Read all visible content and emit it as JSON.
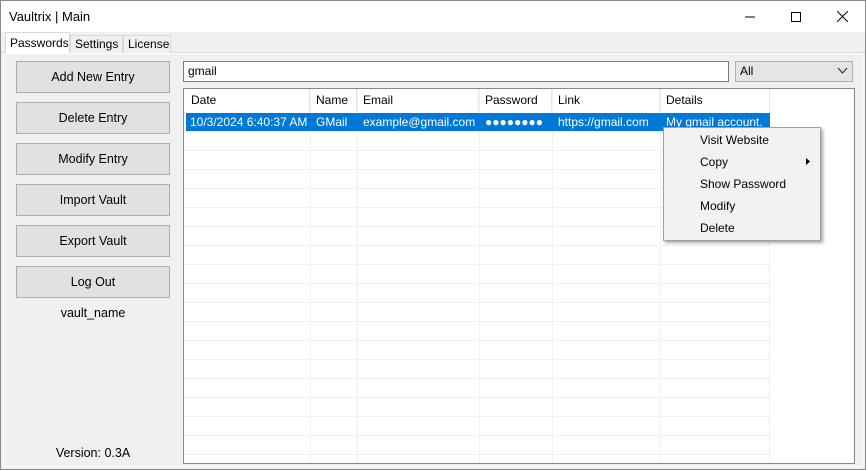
{
  "window": {
    "title": "Vaultrix | Main"
  },
  "tabs": [
    {
      "label": "Passwords"
    },
    {
      "label": "Settings"
    },
    {
      "label": "License"
    }
  ],
  "sidebar": {
    "buttons": [
      {
        "label": "Add New Entry"
      },
      {
        "label": "Delete Entry"
      },
      {
        "label": "Modify Entry"
      },
      {
        "label": "Import Vault"
      },
      {
        "label": "Export Vault"
      },
      {
        "label": "Log Out"
      }
    ],
    "vault_name": "vault_name",
    "version": "Version: 0.3A"
  },
  "search": {
    "value": "gmail"
  },
  "filter": {
    "selected": "All"
  },
  "table": {
    "columns": [
      "Date",
      "Name",
      "Email",
      "Password",
      "Link",
      "Details"
    ],
    "rows": [
      [
        "10/3/2024 6:40:37 AM",
        "GMail",
        "example@gmail.com",
        "●●●●●●●●",
        "https://gmail.com",
        "My gmail account."
      ]
    ]
  },
  "context_menu": {
    "items": [
      {
        "label": "Visit Website"
      },
      {
        "label": "Copy"
      },
      {
        "label": "Show Password"
      },
      {
        "label": "Modify"
      },
      {
        "label": "Delete"
      }
    ]
  },
  "colors": {
    "selection": "#0078d7",
    "window_bg": "#f0f0f0"
  },
  "icons": [
    "minimize-icon",
    "maximize-icon",
    "close-icon",
    "chevron-down-icon",
    "submenu-arrow-icon"
  ]
}
